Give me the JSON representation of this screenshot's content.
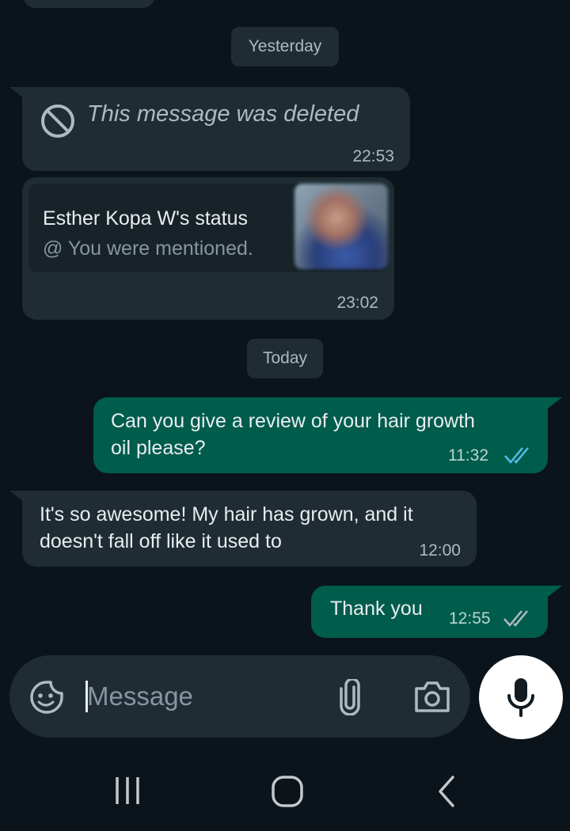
{
  "chat": {
    "date_yesterday": "Yesterday",
    "date_today": "Today",
    "deleted": {
      "text": "This message was deleted",
      "time": "22:53"
    },
    "status_reply": {
      "title": "Esther Kopa W's status",
      "mention": "@ You were mentioned.",
      "time": "23:02"
    },
    "out1": {
      "text_line1": "Can you give a review of your hair growth",
      "text_line2": "oil please?",
      "time": "11:32",
      "ticks_color": "#53bdeb"
    },
    "in1": {
      "text_line1": "It's so awesome! My hair has grown, and it",
      "text_line2": "doesn't fall off like it used to",
      "time": "12:00"
    },
    "out2": {
      "text": "Thank you",
      "time": "12:55",
      "ticks_color": "#aebac1"
    }
  },
  "composer": {
    "placeholder": "Message",
    "icons": [
      "sticker-icon",
      "attach-icon",
      "camera-icon",
      "mic-icon"
    ]
  },
  "navbar": {
    "icons": [
      "recents-icon",
      "home-icon",
      "back-icon"
    ]
  },
  "colors": {
    "background": "#0b141a",
    "incoming": "#1f2c33",
    "outgoing": "#005c4b",
    "read_ticks": "#53bdeb"
  }
}
